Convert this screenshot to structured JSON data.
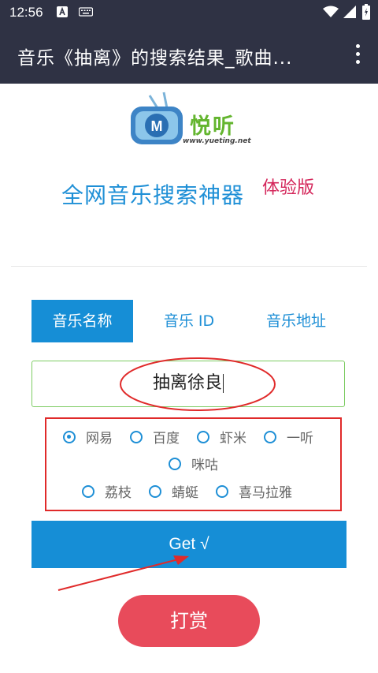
{
  "status_bar": {
    "time": "12:56",
    "icons": [
      "a-notification-icon",
      "keyboard-icon",
      "wifi-icon",
      "signal-icon",
      "battery-icon"
    ]
  },
  "app_bar": {
    "title": "音乐《抽离》的搜索结果_歌曲...",
    "menu_icon": "more-vert-icon"
  },
  "logo": {
    "text": "悦听",
    "url": "www.yueting.net"
  },
  "headline": {
    "title": "全网音乐搜索神器",
    "tag": "体验版"
  },
  "tabs": [
    {
      "label": "音乐名称",
      "active": true
    },
    {
      "label": "音乐 ID",
      "active": false
    },
    {
      "label": "音乐地址",
      "active": false
    }
  ],
  "search": {
    "value": "抽离徐良"
  },
  "sources": [
    {
      "label": "网易",
      "checked": true
    },
    {
      "label": "百度",
      "checked": false
    },
    {
      "label": "虾米",
      "checked": false
    },
    {
      "label": "一听",
      "checked": false
    },
    {
      "label": "咪咕",
      "checked": false
    },
    {
      "label": "荔枝",
      "checked": false
    },
    {
      "label": "蜻蜓",
      "checked": false
    },
    {
      "label": "喜马拉雅",
      "checked": false
    }
  ],
  "buttons": {
    "get": "Get √",
    "tip": "打赏"
  },
  "colors": {
    "bar_background": "#2f3244",
    "accent_blue": "#168ed6",
    "tag_red": "#d4265a",
    "annotation_red": "#e02a2a",
    "tip_button": "#e84b5b",
    "input_border": "#7dcc63"
  }
}
